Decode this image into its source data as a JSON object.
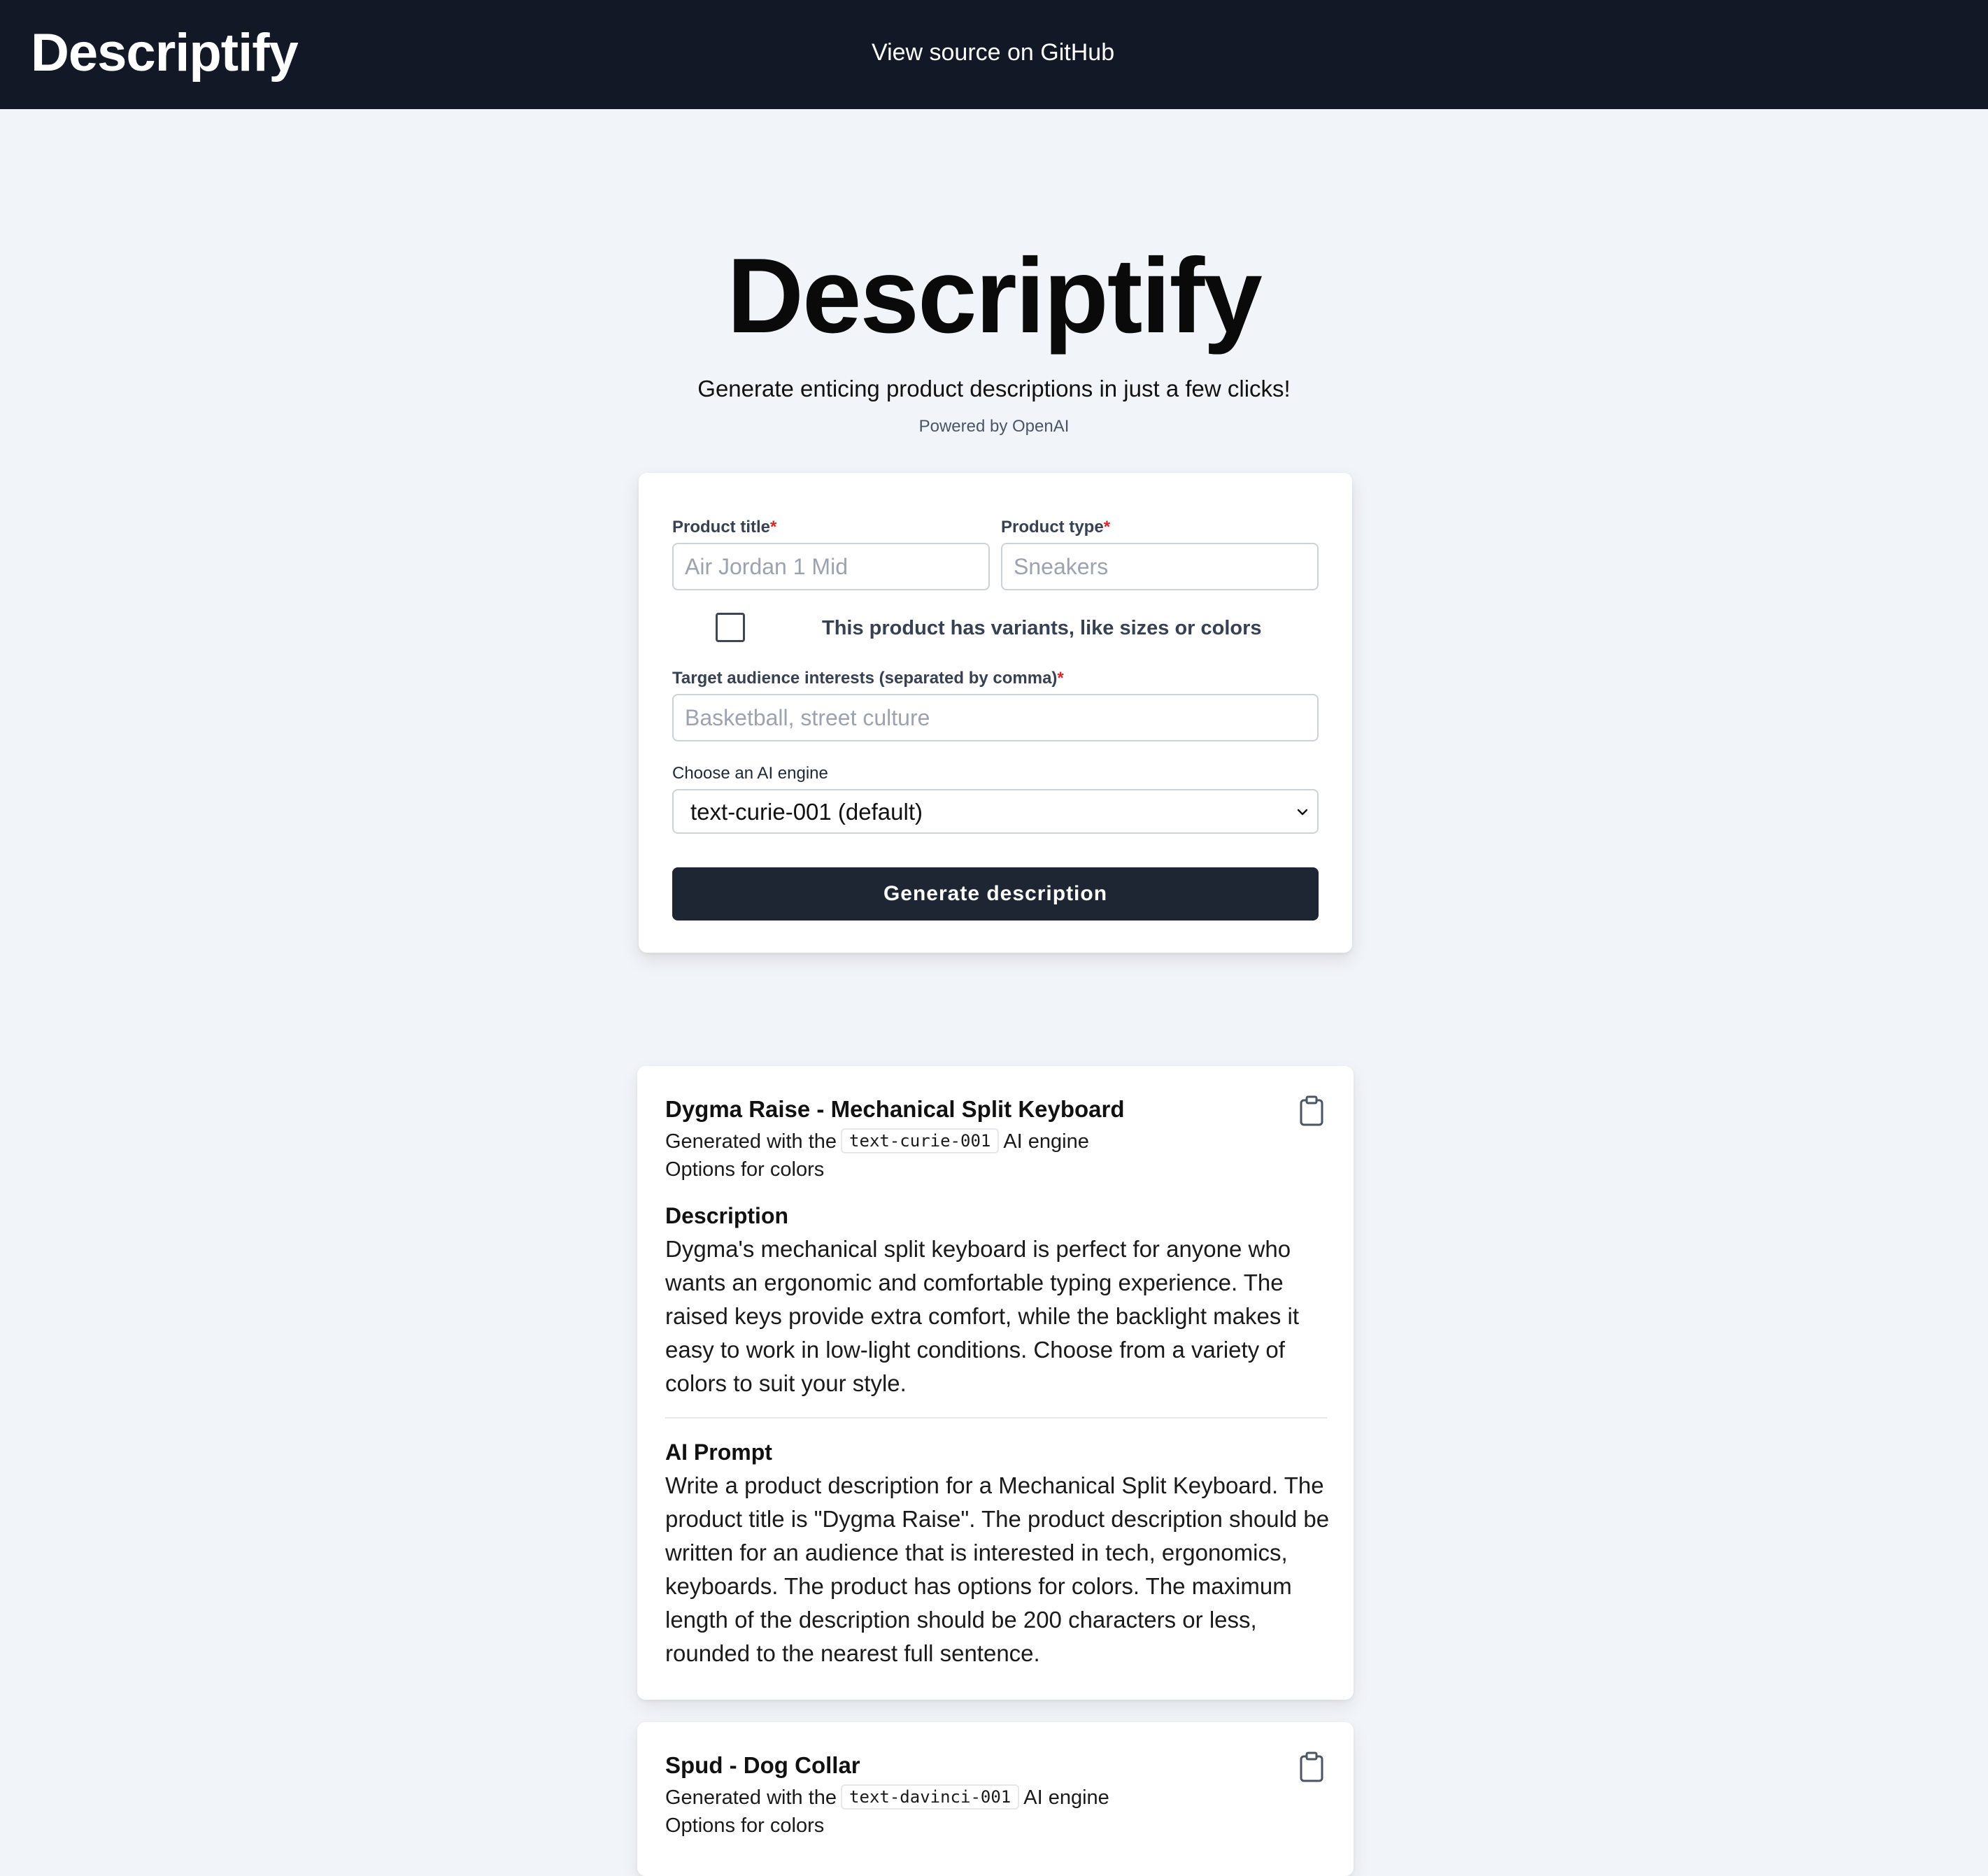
{
  "header": {
    "brand": "Descriptify",
    "github_link": "View source on GitHub"
  },
  "hero": {
    "title": "Descriptify",
    "subtitle": "Generate enticing product descriptions in just a few clicks!",
    "powered_by": "Powered by OpenAI"
  },
  "form": {
    "product_title": {
      "label": "Product title",
      "required_mark": "*",
      "placeholder": "Air Jordan 1 Mid",
      "value": ""
    },
    "product_type": {
      "label": "Product type",
      "required_mark": "*",
      "placeholder": "Sneakers",
      "value": ""
    },
    "variants_checkbox": {
      "label": "This product has variants, like sizes or colors",
      "checked": false
    },
    "audience": {
      "label": "Target audience interests (separated by comma)",
      "required_mark": "*",
      "placeholder": "Basketball, street culture",
      "value": ""
    },
    "engine": {
      "label": "Choose an AI engine",
      "selected": "text-curie-001 (default)"
    },
    "submit_label": "Generate description"
  },
  "results": [
    {
      "title": "Dygma Raise - Mechanical Split Keyboard",
      "generated_prefix": "Generated with the",
      "engine": "text-curie-001",
      "generated_suffix": "AI engine",
      "variants": "Options for colors",
      "description_heading": "Description",
      "description": "Dygma's mechanical split keyboard is perfect for anyone who wants an ergonomic and comfortable typing experience. The raised keys provide extra comfort, while the backlight makes it easy to work in low-light conditions. Choose from a variety of colors to suit your style.",
      "prompt_heading": "AI Prompt",
      "prompt": "Write a product description for a Mechanical Split Keyboard. The product title is \"Dygma Raise\". The product description should be written for an audience that is interested in tech, ergonomics, keyboards. The product has options for colors. The maximum length of the description should be 200 characters or less, rounded to the nearest full sentence."
    },
    {
      "title": "Spud - Dog Collar",
      "generated_prefix": "Generated with the",
      "engine": "text-davinci-001",
      "generated_suffix": "AI engine",
      "variants": "Options for colors"
    }
  ],
  "colors": {
    "header_bg": "#121826",
    "page_bg": "#f1f4f8",
    "button_bg": "#1f2633",
    "required": "#dc2626"
  },
  "icons": {
    "copy": "clipboard-icon",
    "select": "chevron-down-icon"
  }
}
